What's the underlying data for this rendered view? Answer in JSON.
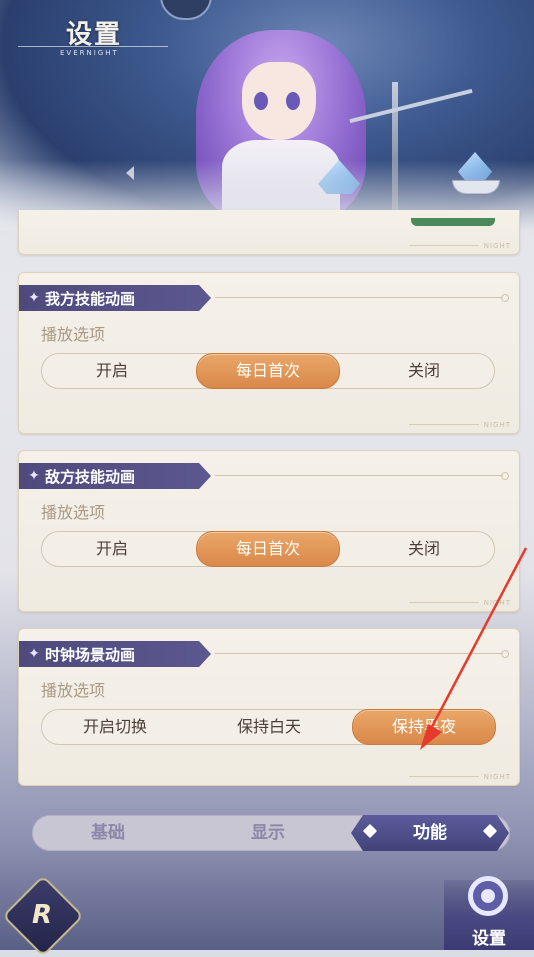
{
  "header": {
    "title": "设置",
    "subtitle": "EVERNIGHT"
  },
  "card_watermark": "NIGHT",
  "sections": [
    {
      "title": "我方技能动画",
      "sub_label": "播放选项",
      "options": [
        "开启",
        "每日首次",
        "关闭"
      ],
      "selected": "每日首次"
    },
    {
      "title": "敌方技能动画",
      "sub_label": "播放选项",
      "options": [
        "开启",
        "每日首次",
        "关闭"
      ],
      "selected": "每日首次"
    },
    {
      "title": "时钟场景动画",
      "sub_label": "播放选项",
      "options": [
        "开启切换",
        "保持白天",
        "保持黑夜"
      ],
      "selected": "保持黑夜"
    }
  ],
  "tabs": {
    "items": [
      "基础",
      "显示",
      "功能"
    ],
    "selected": "功能"
  },
  "bottom_nav": {
    "settings_label": "设置"
  },
  "colors": {
    "active_option": "#d9884a",
    "section_header": "#4e4a7c",
    "active_tab": "#42427a",
    "annotation_arrow": "#e53a2c"
  }
}
